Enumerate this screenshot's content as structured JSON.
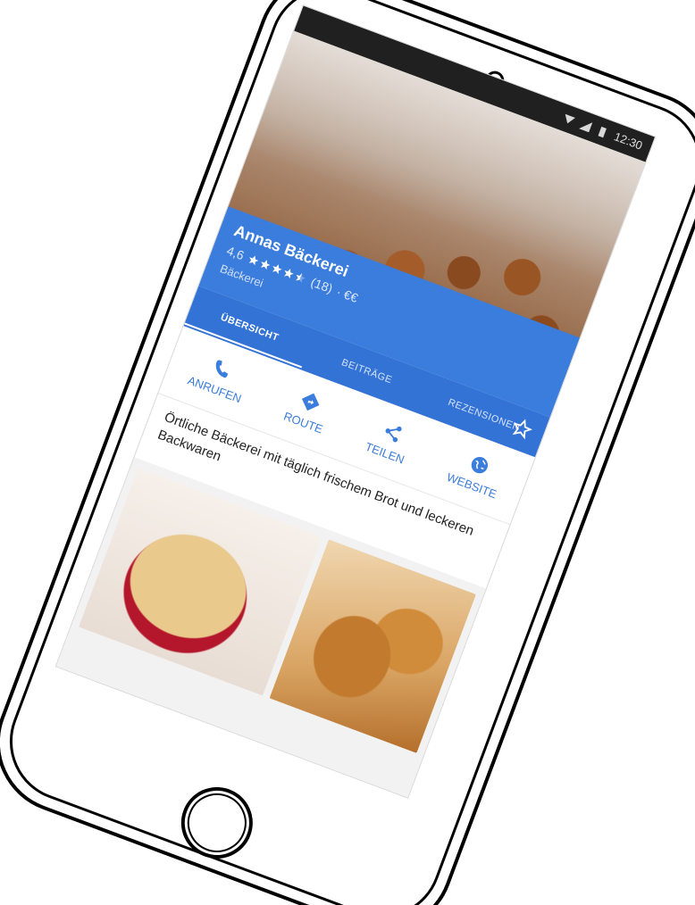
{
  "statusbar": {
    "time": "12:30",
    "icons": [
      "wifi-icon",
      "signal-icon",
      "battery-icon"
    ]
  },
  "place": {
    "name": "Annas Bäckerei",
    "rating": "4,6",
    "stars_filled": 4.5,
    "review_count": "(18)",
    "price": "· €€",
    "category": "Bäckerei"
  },
  "tabs": [
    {
      "label": "ÜBERSICHT",
      "active": true
    },
    {
      "label": "BEITRÄGE",
      "active": false
    },
    {
      "label": "REZENSIONEN",
      "active": false
    }
  ],
  "favorite": {
    "icon": "star-outline-icon"
  },
  "actions": [
    {
      "label": "ANRUFEN",
      "icon": "phone-icon"
    },
    {
      "label": "ROUTE",
      "icon": "directions-icon"
    },
    {
      "label": "TEILEN",
      "icon": "share-icon"
    },
    {
      "label": "WEBSITE",
      "icon": "globe-icon"
    }
  ],
  "description": "Örtliche Bäckerei mit täglich frischem Brot und leckeren Backwaren",
  "colors": {
    "accent": "#3b7ddd",
    "tabbar": "#3473d6",
    "statusbar": "#202020"
  }
}
